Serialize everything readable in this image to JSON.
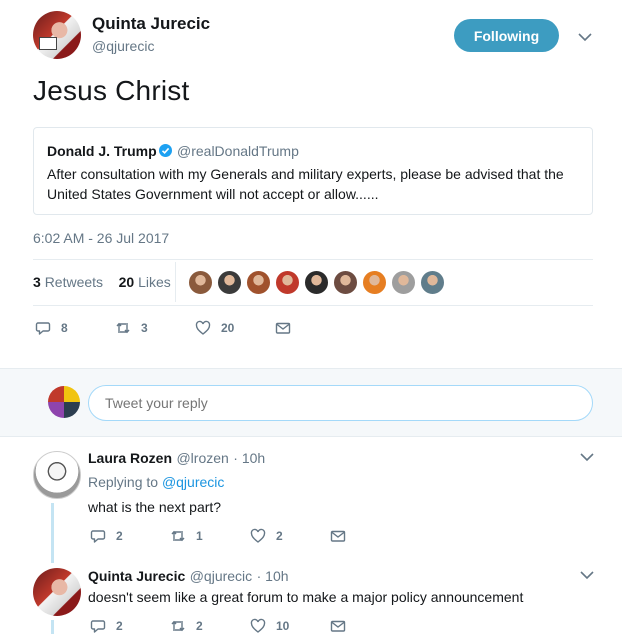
{
  "tweet": {
    "author_name": "Quinta Jurecic",
    "author_handle": "@qjurecic",
    "follow_label": "Following",
    "text": "Jesus Christ",
    "timestamp": "6:02 AM - 26 Jul 2017",
    "retweets_count": "3",
    "retweets_label": "Retweets",
    "likes_count": "20",
    "likes_label": "Likes",
    "actions": {
      "replies": "8",
      "retweets": "3",
      "likes": "20"
    }
  },
  "quote": {
    "author_name": "Donald J. Trump",
    "author_handle": "@realDonaldTrump",
    "text": "After consultation with my Generals and military experts, please be advised that the United States Government will not accept or allow......"
  },
  "likers": {
    "colors": [
      "#8a5a3c",
      "#3b3b3b",
      "#a0522d",
      "#c0392b",
      "#2b2b2b",
      "#6d4c41",
      "#e67e22",
      "#9e9e9e",
      "#607d8b"
    ]
  },
  "reply_box": {
    "placeholder": "Tweet your reply"
  },
  "replies": [
    {
      "name": "Laura Rozen",
      "handle": "@lrozen",
      "time": "· 10h",
      "replying_prefix": "Replying to",
      "replying_to": "@qjurecic",
      "text": "what is the next part?",
      "actions": {
        "replies": "2",
        "retweets": "1",
        "likes": "2"
      }
    },
    {
      "name": "Quinta Jurecic",
      "handle": "@qjurecic",
      "time": "· 10h",
      "text": "doesn't seem like a great forum to make a major policy announcement",
      "actions": {
        "replies": "2",
        "retweets": "2",
        "likes": "10"
      }
    }
  ],
  "icons": {
    "verified": "verified-badge-icon",
    "reply": "reply-icon",
    "retweet": "retweet-icon",
    "like": "heart-icon",
    "dm": "envelope-icon",
    "caret": "chevron-down-icon"
  },
  "colors": {
    "accent": "#1b95e0",
    "follow_button": "#3d9cc1",
    "muted": "#657786"
  }
}
